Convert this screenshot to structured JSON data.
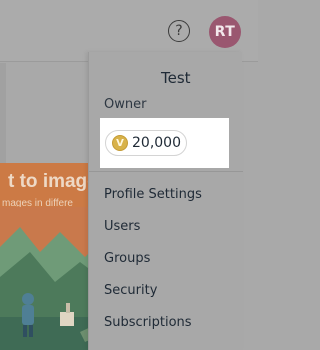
{
  "header": {
    "help_icon": "question-circle-icon",
    "help_glyph": "?",
    "avatar_initials": "RT"
  },
  "hero": {
    "title": "t to image",
    "subtitle": "mages in differe"
  },
  "menu": {
    "user_name": "Test",
    "role": "Owner",
    "credits": {
      "coin_icon": "coin-icon",
      "coin_glyph": "V",
      "value": "20,000"
    },
    "items": [
      {
        "label": "Profile Settings"
      },
      {
        "label": "Users"
      },
      {
        "label": "Groups"
      },
      {
        "label": "Security"
      },
      {
        "label": "Subscriptions"
      }
    ]
  },
  "colors": {
    "avatar_bg": "#9a5770",
    "coin": "#d8b24a",
    "overlay": "#a8a8a8"
  }
}
